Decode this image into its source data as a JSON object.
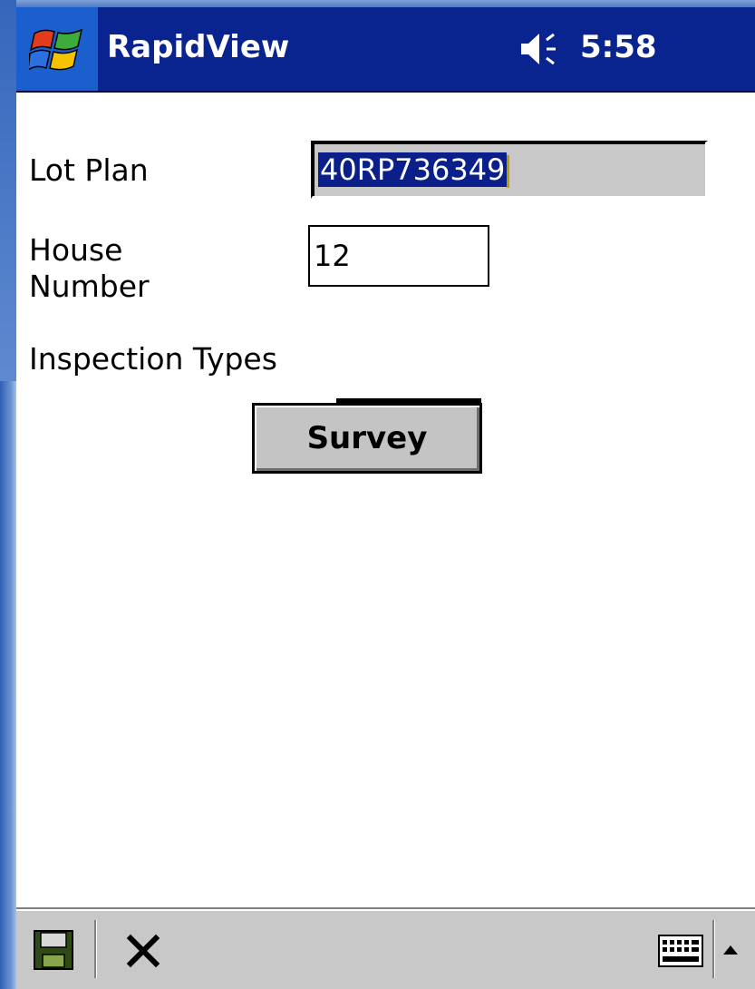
{
  "titlebar": {
    "app_title": "RapidView",
    "time": "5:58",
    "icons": [
      "windows-start-icon",
      "speaker-icon"
    ]
  },
  "form": {
    "lot_plan_label": "Lot Plan",
    "lot_plan_value": "40RP736349",
    "house_number_label_line1": "House",
    "house_number_label_line2": "Number",
    "house_number_value": "12",
    "inspection_types_label": "Inspection Types",
    "survey_button_label": "Survey"
  },
  "commandbar": {
    "icons": [
      "save-icon",
      "close-icon",
      "keyboard-icon",
      "up-arrow-icon"
    ]
  },
  "colors": {
    "titlebar": "#0a248f",
    "selection": "#0a1f8a",
    "command_bar": "#c8c8c8",
    "button": "#c4c4c4"
  }
}
